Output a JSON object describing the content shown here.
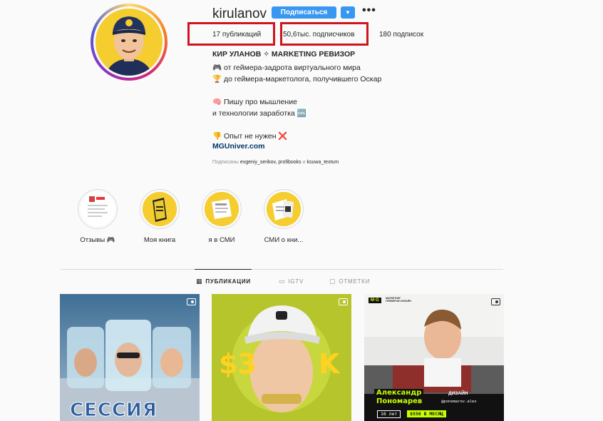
{
  "profile": {
    "username": "kirulanov",
    "follow_label": "Подписаться",
    "more_label": "•••",
    "posts_stat": "17 публикаций",
    "followers_stat": "50,6тыс. подписчиков",
    "following_stat": "180 подписок"
  },
  "bio": {
    "name": "КИР УЛАНОВ ✧ MARKETING РЕВИЗОР",
    "lines": [
      "🎮 от геймера-задрота виртуального мира",
      "🏆 до геймера-маркетолога, получившего Оскар",
      "🧠 Пишу про мышление",
      "и технологии заработка 🆒",
      "👎 Опыт не нужен ❌"
    ],
    "link": "MGUniver.com",
    "followed_by_prefix": "Подписаны",
    "followed_by_names": "evgeniy_serikov, profibooks",
    "followed_by_and": "и",
    "followed_by_last": "ksuwa_textum"
  },
  "highlights": [
    {
      "label": "Отзывы 🎮"
    },
    {
      "label": "Моя книга"
    },
    {
      "label": "я в СМИ"
    },
    {
      "label": "СМИ о кни..."
    }
  ],
  "tabs": [
    {
      "label": "ПУБЛИКАЦИИ",
      "icon": "grid-icon",
      "active": true
    },
    {
      "label": "IGTV",
      "icon": "igtv-icon",
      "active": false
    },
    {
      "label": "ОТМЕТКИ",
      "icon": "tag-icon",
      "active": false
    }
  ],
  "posts": [
    {
      "overlay_text": "СЕССИЯ"
    },
    {
      "overlay_left": "$3",
      "overlay_right": "K"
    },
    {
      "badge": "M·G",
      "badge_sub": "МАРКЕТИНГ ГЕЙМЕРОВ ОНЛАЙН",
      "name_line1": "Александр",
      "name_line2": "Пономарев",
      "role": "ДИЗАЙН",
      "handle": "@ponomarov.alex",
      "age": "16 лет",
      "income": "$550 В МЕСЯЦ"
    }
  ],
  "colors": {
    "accent": "#3897f0",
    "highlight_box": "#d0141e",
    "link": "#003569",
    "post3_accent": "#c8ff00"
  }
}
